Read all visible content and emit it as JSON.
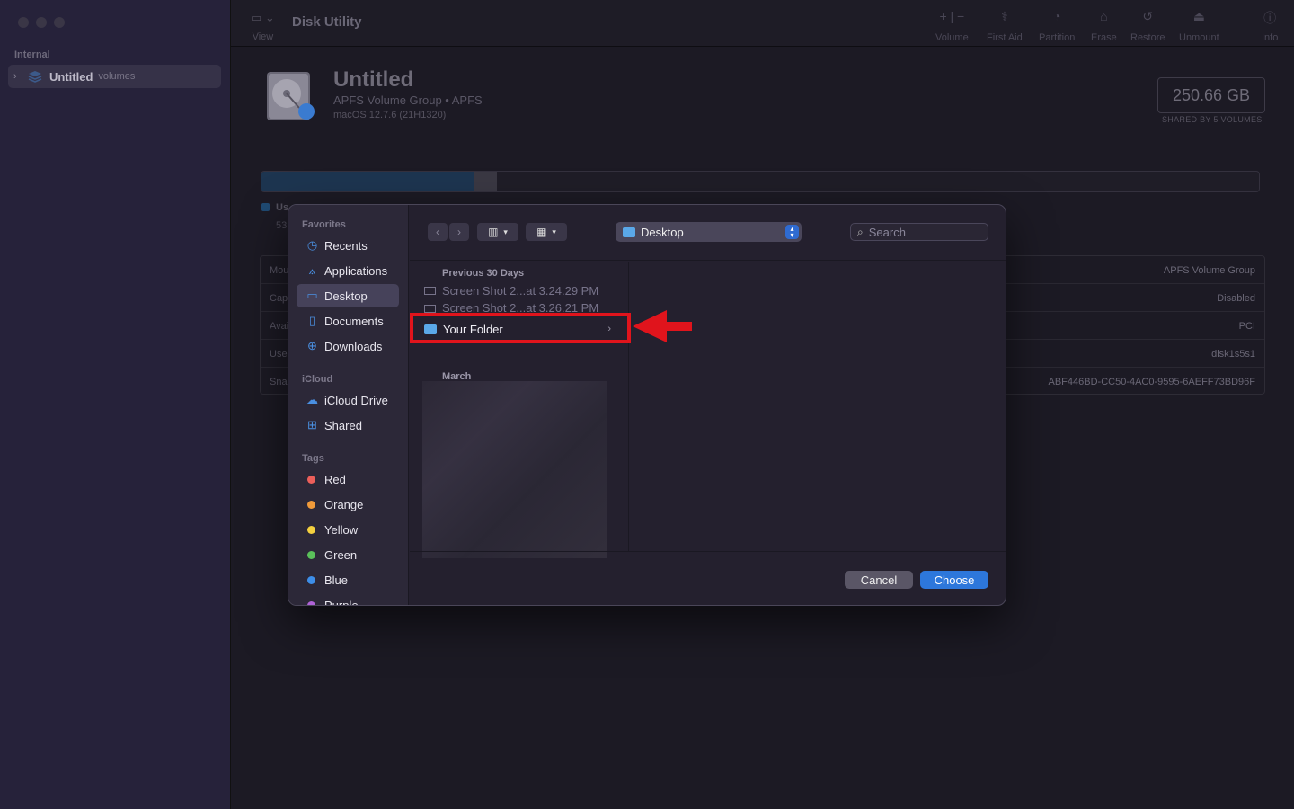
{
  "window": {
    "title": "Disk Utility",
    "toolbar": {
      "view_label": "View",
      "buttons": [
        {
          "label": "Volume",
          "icon": "plus-minus-icon"
        },
        {
          "label": "First Aid",
          "icon": "stethoscope-icon"
        },
        {
          "label": "Partition",
          "icon": "pie-chart-icon"
        },
        {
          "label": "Erase",
          "icon": "erase-drive-icon"
        },
        {
          "label": "Restore",
          "icon": "restore-icon"
        },
        {
          "label": "Unmount",
          "icon": "eject-icon"
        },
        {
          "label": "Info",
          "icon": "info-icon"
        }
      ]
    }
  },
  "sidebar": {
    "section": "Internal",
    "item": {
      "name": "Untitled",
      "sub": "volumes"
    }
  },
  "detail": {
    "title": "Untitled",
    "subtitle": "APFS Volume Group • APFS",
    "os": "macOS 12.7.6 (21H1320)",
    "capacity": "250.66 GB",
    "capacity_sub": "SHARED BY 5 VOLUMES",
    "legend_label": "Us",
    "legend_value": "53",
    "used_fraction": 0.213,
    "info_rows": [
      {
        "key": "Mou",
        "value": "APFS Volume Group"
      },
      {
        "key": "Cap",
        "value": "Disabled"
      },
      {
        "key": "Avai",
        "value": "PCI"
      },
      {
        "key": "Use",
        "value": "disk1s5s1"
      },
      {
        "key": "Sna",
        "value": "ABF446BD-CC50-4AC0-9595-6AEFF73BD96F"
      }
    ]
  },
  "dialog": {
    "favorites_header": "Favorites",
    "favorites": [
      {
        "label": "Recents",
        "icon": "clock-icon",
        "selected": false
      },
      {
        "label": "Applications",
        "icon": "applications-icon",
        "selected": false
      },
      {
        "label": "Desktop",
        "icon": "desktop-icon",
        "selected": true
      },
      {
        "label": "Documents",
        "icon": "document-icon",
        "selected": false
      },
      {
        "label": "Downloads",
        "icon": "download-icon",
        "selected": false
      }
    ],
    "icloud_header": "iCloud",
    "icloud": [
      {
        "label": "iCloud Drive",
        "icon": "cloud-icon"
      },
      {
        "label": "Shared",
        "icon": "shared-folder-icon"
      }
    ],
    "tags_header": "Tags",
    "tags": [
      {
        "label": "Red",
        "color": "#ec5f5a"
      },
      {
        "label": "Orange",
        "color": "#f09a3a"
      },
      {
        "label": "Yellow",
        "color": "#f4d03f"
      },
      {
        "label": "Green",
        "color": "#5ac05a"
      },
      {
        "label": "Blue",
        "color": "#3d8ee8"
      },
      {
        "label": "Purple",
        "color": "#b063d8"
      }
    ],
    "location": "Desktop",
    "search_placeholder": "Search",
    "group1_header": "Previous 30 Days",
    "files": [
      "Screen Shot 2...at 3.24.29 PM",
      "Screen Shot 2...at 3.26.21 PM"
    ],
    "folder": "Your Folder",
    "group2_header": "March",
    "cancel_label": "Cancel",
    "choose_label": "Choose"
  },
  "colors": {
    "accent": "#2d77db",
    "highlight": "#e0141c"
  }
}
